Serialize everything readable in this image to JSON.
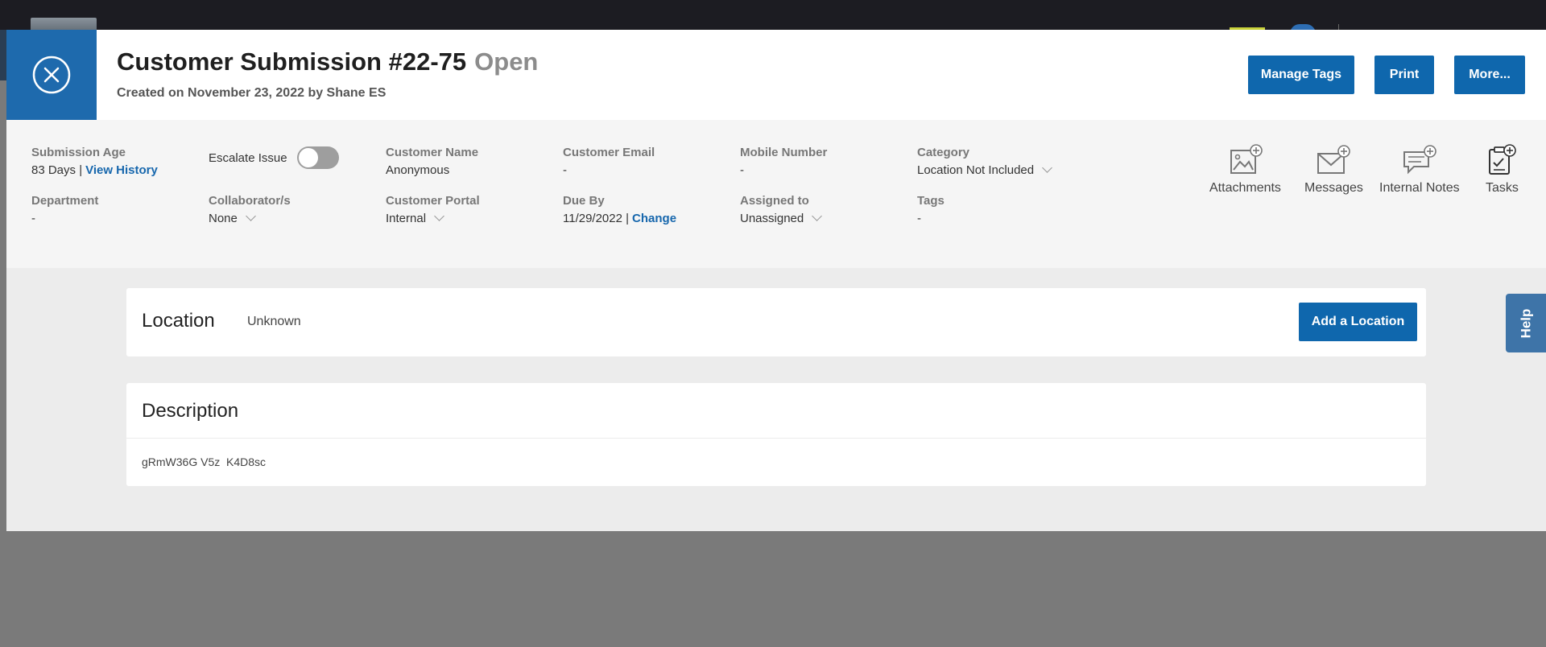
{
  "colors": {
    "primary": "#0f67ad",
    "link": "#1767ad",
    "overlay": "#7a7a7a"
  },
  "header": {
    "title": "Customer Submission #22-75",
    "status": "Open",
    "subtitle": "Created on November 23, 2022 by Shane ES",
    "close_icon": "close-circle-icon",
    "buttons": {
      "manage_tags": "Manage Tags",
      "print": "Print",
      "more": "More..."
    }
  },
  "details": {
    "submission_age": {
      "label": "Submission Age",
      "value": "83 Days |",
      "link": "View History"
    },
    "escalate": {
      "label": "Escalate Issue",
      "on": false
    },
    "customer_name": {
      "label": "Customer Name",
      "value": "Anonymous"
    },
    "customer_email": {
      "label": "Customer Email",
      "value": "-"
    },
    "mobile_number": {
      "label": "Mobile Number",
      "value": "-"
    },
    "category": {
      "label": "Category",
      "value": "Location Not Included"
    },
    "department": {
      "label": "Department",
      "value": "-"
    },
    "collaborators": {
      "label": "Collaborator/s",
      "value": "None"
    },
    "customer_portal": {
      "label": "Customer Portal",
      "value": "Internal"
    },
    "due_by": {
      "label": "Due By",
      "value": "11/29/2022 |",
      "link": "Change"
    },
    "assigned_to": {
      "label": "Assigned to",
      "value": "Unassigned"
    },
    "tags": {
      "label": "Tags",
      "value": "-"
    }
  },
  "tools": [
    {
      "label": "Attachments",
      "icon": "attachment-image-icon"
    },
    {
      "label": "Messages",
      "icon": "envelope-add-icon"
    },
    {
      "label": "Internal Notes",
      "icon": "note-bubble-icon"
    },
    {
      "label": "Tasks",
      "icon": "clipboard-check-icon"
    }
  ],
  "location": {
    "title": "Location",
    "value": "Unknown",
    "button": "Add a Location"
  },
  "description": {
    "title": "Description",
    "text": "gRmW36G V5z  K4D8sc"
  },
  "help": {
    "label": "Help"
  }
}
